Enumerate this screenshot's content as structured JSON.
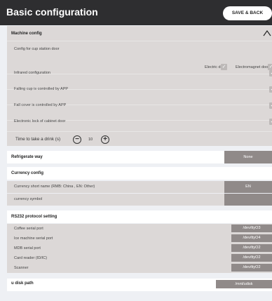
{
  "header": {
    "title": "Basic configuration",
    "save_label": "SAVE & BACK"
  },
  "machine": {
    "title": "Machine config",
    "door_label": "Config for cup station door",
    "electric_door": "Electric door",
    "magnet_door": "Electromagnet door",
    "rows": [
      {
        "label": "Infrared configuration",
        "checked": true
      },
      {
        "label": "Falling cup is controlled by APP",
        "checked": true
      },
      {
        "label": "Fall cover is controlled by APP",
        "checked": true
      },
      {
        "label": "Electronic lock of cabinet door",
        "checked": true
      }
    ],
    "drink_label": "Time to take a drink (s)",
    "drink_value": "10"
  },
  "refrigerate": {
    "label": "Refrigerate way",
    "value": "None"
  },
  "currency": {
    "title": "Currency config",
    "short_name_label": "Currency short name (RMB: China , EN: Other)",
    "short_name_value": "EN",
    "symbol_label": "currency symbol",
    "symbol_value": ""
  },
  "rs232": {
    "title": "RS232 protocol setting",
    "ports": [
      {
        "label": "Coffee serial port",
        "value": "/dev/ttyO3"
      },
      {
        "label": "Ice machine serial port",
        "value": "/dev/ttyO4"
      },
      {
        "label": "MDB serial port",
        "value": "/dev/ttyO2"
      },
      {
        "label": "Card reader (ID/IC)",
        "value": "/dev/ttyO2"
      },
      {
        "label": "Scanner",
        "value": "/dev/ttyO2"
      }
    ]
  },
  "udisk": {
    "label": "u disk path",
    "value": "/mnt/udisk"
  }
}
